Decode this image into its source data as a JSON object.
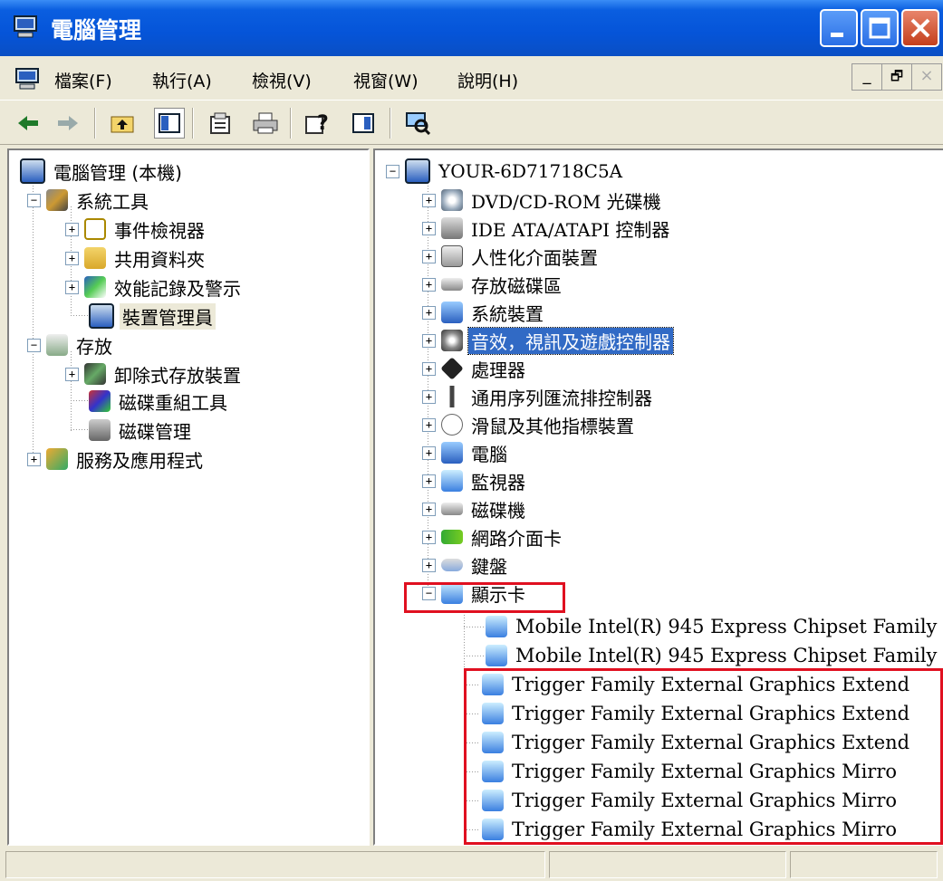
{
  "window": {
    "title": "電腦管理"
  },
  "menu": [
    "檔案(F)",
    "執行(A)",
    "檢視(V)",
    "視窗(W)",
    "說明(H)"
  ],
  "mdi_controls": [
    "_",
    "🗗",
    "×"
  ],
  "toolbar_icons": [
    "back-arrow-icon",
    "forward-arrow-icon",
    "up-folder-icon",
    "show-hide-tree-icon",
    "properties-icon",
    "print-icon",
    "help-icon",
    "export-list-icon",
    "scan-hardware-icon"
  ],
  "left_tree": [
    {
      "label": "電腦管理 (本機)"
    },
    {
      "label": "系統工具"
    },
    {
      "label": "事件檢視器"
    },
    {
      "label": "共用資料夾"
    },
    {
      "label": "效能記錄及警示"
    },
    {
      "label": "裝置管理員"
    },
    {
      "label": "存放"
    },
    {
      "label": "卸除式存放裝置"
    },
    {
      "label": "磁碟重組工具"
    },
    {
      "label": "磁碟管理"
    },
    {
      "label": "服務及應用程式"
    }
  ],
  "right_tree": {
    "root": "YOUR-6D71718C5A",
    "categories": [
      "DVD/CD-ROM 光碟機",
      "IDE ATA/ATAPI 控制器",
      "人性化介面裝置",
      "存放磁碟區",
      "系統裝置",
      "音效，視訊及遊戲控制器",
      "處理器",
      "通用序列匯流排控制器",
      "滑鼠及其他指標裝置",
      "電腦",
      "監視器",
      "磁碟機",
      "網路介面卡",
      "鍵盤",
      "顯示卡"
    ],
    "display_devices": [
      "Mobile Intel(R) 945 Express Chipset Family",
      "Mobile Intel(R) 945 Express Chipset Family",
      "Trigger Family External Graphics Extend",
      "Trigger Family External Graphics Extend",
      "Trigger Family External Graphics Extend",
      "Trigger Family External Graphics Mirro",
      "Trigger Family External Graphics Mirro",
      "Trigger Family External Graphics Mirro"
    ]
  },
  "colors": {
    "title_bar": "#0554d8",
    "selection": "#316ac5",
    "highlight_box": "#e01020"
  }
}
